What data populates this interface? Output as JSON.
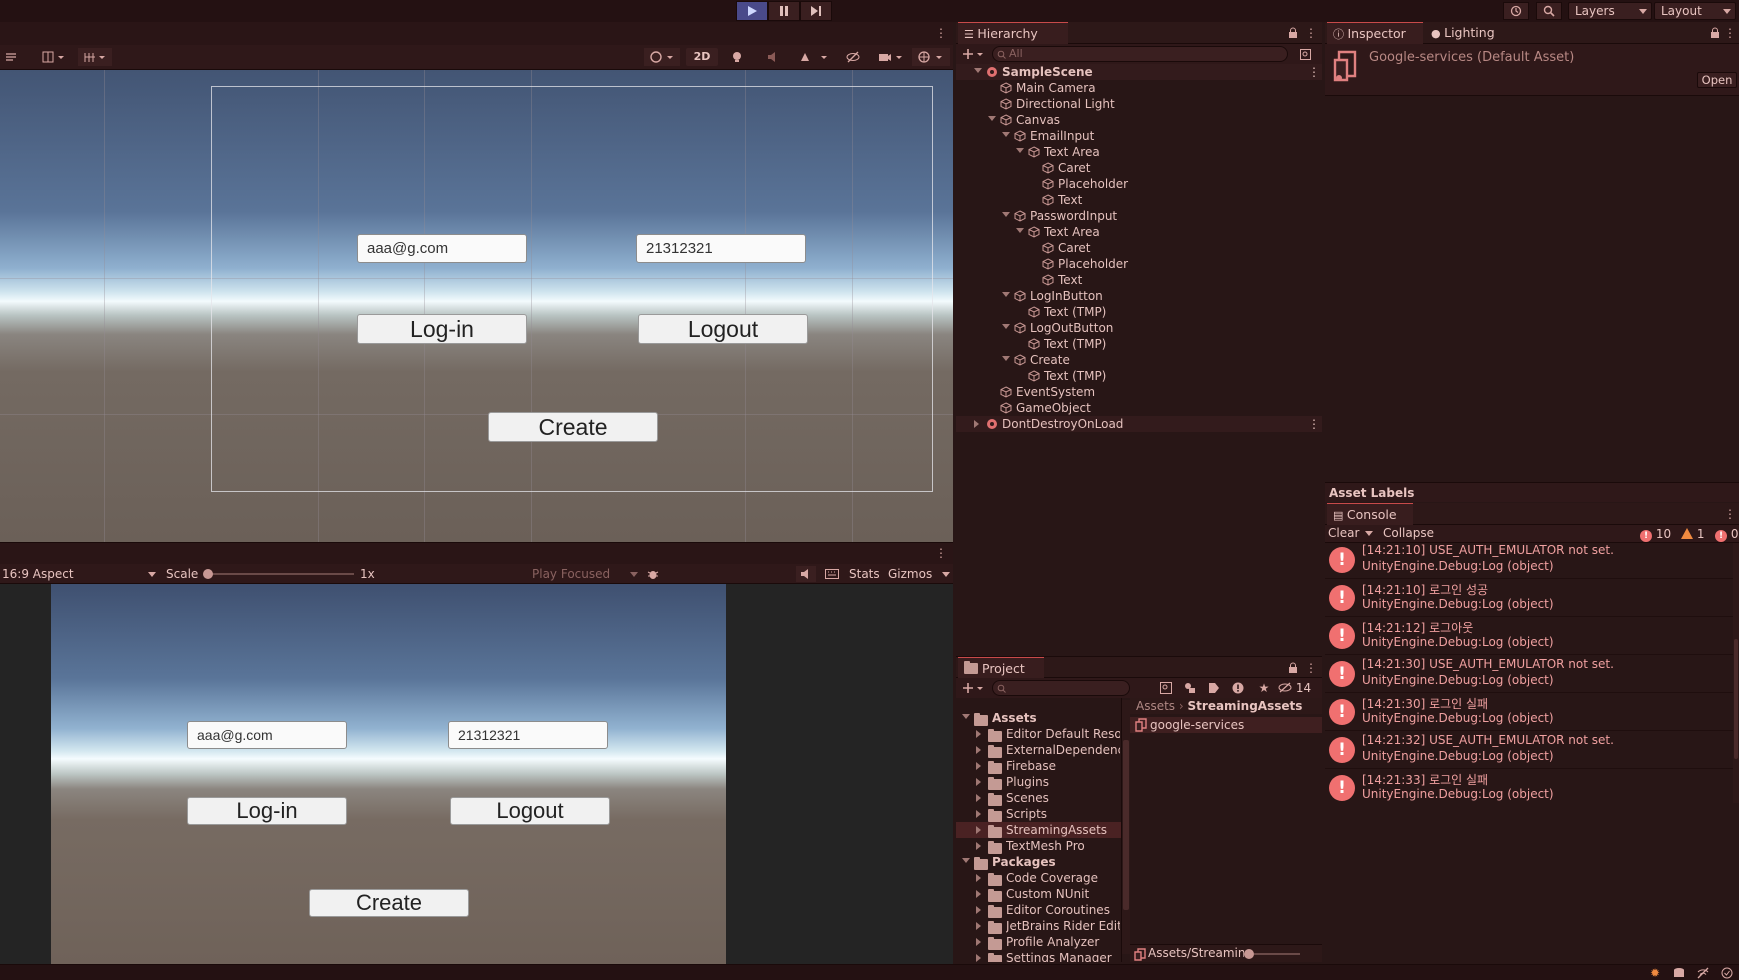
{
  "toolbar": {
    "layers_label": "Layers",
    "layout_label": "Layout"
  },
  "scene": {
    "mode_2d": "2D",
    "email_value": "aaa@g.com",
    "password_value": "21312321",
    "login_label": "Log-in",
    "logout_label": "Logout",
    "create_label": "Create"
  },
  "game": {
    "aspect": "16:9 Aspect",
    "scale_label": "Scale",
    "scale_value": "1x",
    "play_focused": "Play Focused",
    "stats": "Stats",
    "gizmos": "Gizmos",
    "email_value": "aaa@g.com",
    "password_value": "21312321",
    "login_label": "Log-in",
    "logout_label": "Logout",
    "create_label": "Create"
  },
  "hierarchy": {
    "title": "Hierarchy",
    "search_placeholder": "All",
    "items": [
      {
        "label": "SampleScene",
        "indent": 0,
        "kind": "scene",
        "arrow": "open"
      },
      {
        "label": "Main Camera",
        "indent": 1,
        "kind": "go",
        "arrow": "none"
      },
      {
        "label": "Directional Light",
        "indent": 1,
        "kind": "go",
        "arrow": "none"
      },
      {
        "label": "Canvas",
        "indent": 1,
        "kind": "go",
        "arrow": "open"
      },
      {
        "label": "EmailInput",
        "indent": 2,
        "kind": "go",
        "arrow": "open"
      },
      {
        "label": "Text Area",
        "indent": 3,
        "kind": "go",
        "arrow": "open"
      },
      {
        "label": "Caret",
        "indent": 4,
        "kind": "go",
        "arrow": "none"
      },
      {
        "label": "Placeholder",
        "indent": 4,
        "kind": "go",
        "arrow": "none"
      },
      {
        "label": "Text",
        "indent": 4,
        "kind": "go",
        "arrow": "none"
      },
      {
        "label": "PasswordInput",
        "indent": 2,
        "kind": "go",
        "arrow": "open"
      },
      {
        "label": "Text Area",
        "indent": 3,
        "kind": "go",
        "arrow": "open"
      },
      {
        "label": "Caret",
        "indent": 4,
        "kind": "go",
        "arrow": "none"
      },
      {
        "label": "Placeholder",
        "indent": 4,
        "kind": "go",
        "arrow": "none"
      },
      {
        "label": "Text",
        "indent": 4,
        "kind": "go",
        "arrow": "none"
      },
      {
        "label": "LogInButton",
        "indent": 2,
        "kind": "go",
        "arrow": "open"
      },
      {
        "label": "Text (TMP)",
        "indent": 3,
        "kind": "go",
        "arrow": "none"
      },
      {
        "label": "LogOutButton",
        "indent": 2,
        "kind": "go",
        "arrow": "open"
      },
      {
        "label": "Text (TMP)",
        "indent": 3,
        "kind": "go",
        "arrow": "none"
      },
      {
        "label": "Create",
        "indent": 2,
        "kind": "go",
        "arrow": "open"
      },
      {
        "label": "Text (TMP)",
        "indent": 3,
        "kind": "go",
        "arrow": "none"
      },
      {
        "label": "EventSystem",
        "indent": 1,
        "kind": "go",
        "arrow": "none"
      },
      {
        "label": "GameObject",
        "indent": 1,
        "kind": "go",
        "arrow": "none"
      },
      {
        "label": "DontDestroyOnLoad",
        "indent": 0,
        "kind": "scene",
        "arrow": "closed"
      }
    ]
  },
  "inspector": {
    "tab": "Inspector",
    "lighting_tab": "Lighting",
    "asset_title": "Google-services (Default Asset)",
    "open_button": "Open",
    "asset_labels": "Asset Labels"
  },
  "console": {
    "title": "Console",
    "clear": "Clear",
    "collapse": "Collapse",
    "error_count": "10",
    "warn_count": "1",
    "info_count": "0",
    "entries": [
      {
        "line1": "[14:21:10] USE_AUTH_EMULATOR not set.",
        "line2": "UnityEngine.Debug:Log (object)"
      },
      {
        "line1": "[14:21:10] 로그인 성공",
        "line2": "UnityEngine.Debug:Log (object)"
      },
      {
        "line1": "[14:21:12] 로그아웃",
        "line2": "UnityEngine.Debug:Log (object)"
      },
      {
        "line1": "[14:21:30] USE_AUTH_EMULATOR not set.",
        "line2": "UnityEngine.Debug:Log (object)"
      },
      {
        "line1": "[14:21:30] 로그인 실패",
        "line2": "UnityEngine.Debug:Log (object)"
      },
      {
        "line1": "[14:21:32] USE_AUTH_EMULATOR not set.",
        "line2": "UnityEngine.Debug:Log (object)"
      },
      {
        "line1": "[14:21:33] 로그인 실패",
        "line2": "UnityEngine.Debug:Log (object)"
      }
    ]
  },
  "project": {
    "title": "Project",
    "hidden_count": "14",
    "breadcrumb_root": "Assets",
    "breadcrumb_current": "StreamingAssets",
    "selected_file": "google-services",
    "footer_path": "Assets/Streaming",
    "tree": [
      {
        "label": "Assets",
        "level": 0,
        "bold": true
      },
      {
        "label": "Editor Default Resou",
        "level": 1
      },
      {
        "label": "ExternalDependency",
        "level": 1
      },
      {
        "label": "Firebase",
        "level": 1
      },
      {
        "label": "Plugins",
        "level": 1
      },
      {
        "label": "Scenes",
        "level": 1
      },
      {
        "label": "Scripts",
        "level": 1
      },
      {
        "label": "StreamingAssets",
        "level": 1,
        "selected": true
      },
      {
        "label": "TextMesh Pro",
        "level": 1
      },
      {
        "label": "Packages",
        "level": 0,
        "bold": true
      },
      {
        "label": "Code Coverage",
        "level": 1
      },
      {
        "label": "Custom NUnit",
        "level": 1
      },
      {
        "label": "Editor Coroutines",
        "level": 1
      },
      {
        "label": "JetBrains Rider Edito",
        "level": 1
      },
      {
        "label": "Profile Analyzer",
        "level": 1
      },
      {
        "label": "Settings Manager",
        "level": 1
      }
    ]
  }
}
